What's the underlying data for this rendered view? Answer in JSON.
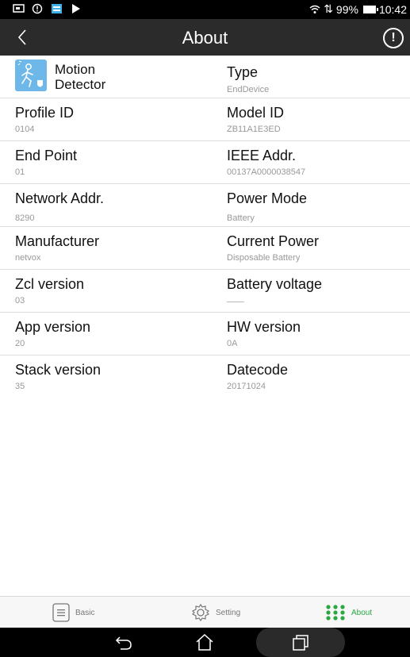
{
  "status_bar": {
    "battery_percent": "99%",
    "time": "10:42"
  },
  "header": {
    "title": "About"
  },
  "device": {
    "name_line1": "Motion",
    "name_line2": "Detector",
    "icon": "motion-detector-icon"
  },
  "fields": [
    {
      "left_label": "",
      "left_value": "",
      "right_label": "Type",
      "right_value": "EndDevice"
    },
    {
      "left_label": "Profile ID",
      "left_value": "0104",
      "right_label": "Model ID",
      "right_value": "ZB11A1E3ED"
    },
    {
      "left_label": "End Point",
      "left_value": "01",
      "right_label": "IEEE Addr.",
      "right_value": "00137A0000038547"
    },
    {
      "left_label": "Network Addr.",
      "left_value": "8290",
      "right_label": "Power Mode",
      "right_value": "Battery"
    },
    {
      "left_label": "Manufacturer",
      "left_value": "netvox",
      "right_label": "Current Power",
      "right_value": "Disposable Battery"
    },
    {
      "left_label": "Zcl version",
      "left_value": "03",
      "right_label": "Battery voltage",
      "right_value": ""
    },
    {
      "left_label": "App version",
      "left_value": "20",
      "right_label": "HW version",
      "right_value": "0A"
    },
    {
      "left_label": "Stack version",
      "left_value": "35",
      "right_label": "Datecode",
      "right_value": "20171024"
    }
  ],
  "tabs": [
    {
      "label": "Basic",
      "icon": "list-icon",
      "active": false
    },
    {
      "label": "Setting",
      "icon": "gear-icon",
      "active": false
    },
    {
      "label": "About",
      "icon": "dots-grid-icon",
      "active": true
    }
  ],
  "colors": {
    "header_bg": "#2b2b2b",
    "accent_active": "#29a843",
    "label_text": "#111111",
    "value_text": "#999999"
  }
}
